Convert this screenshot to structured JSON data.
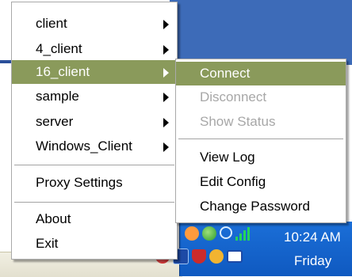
{
  "main_menu": {
    "items": [
      {
        "label": "client",
        "has_submenu": true
      },
      {
        "label": "4_client",
        "has_submenu": true
      },
      {
        "label": "16_client",
        "has_submenu": true,
        "highlighted": true
      },
      {
        "label": "sample",
        "has_submenu": true
      },
      {
        "label": "server",
        "has_submenu": true
      },
      {
        "label": "Windows_Client",
        "has_submenu": true
      }
    ],
    "proxy_settings": "Proxy Settings",
    "about": "About",
    "exit": "Exit"
  },
  "sub_menu": {
    "connect": "Connect",
    "disconnect": "Disconnect",
    "show_status": "Show Status",
    "view_log": "View Log",
    "edit_config": "Edit Config",
    "change_password": "Change Password"
  },
  "taskbar": {
    "time": "10:24 AM",
    "day": "Friday"
  },
  "colors": {
    "highlight": "#8a9a5b",
    "taskbar": "#1b6fd8",
    "desktop": "#3d6bb8"
  }
}
